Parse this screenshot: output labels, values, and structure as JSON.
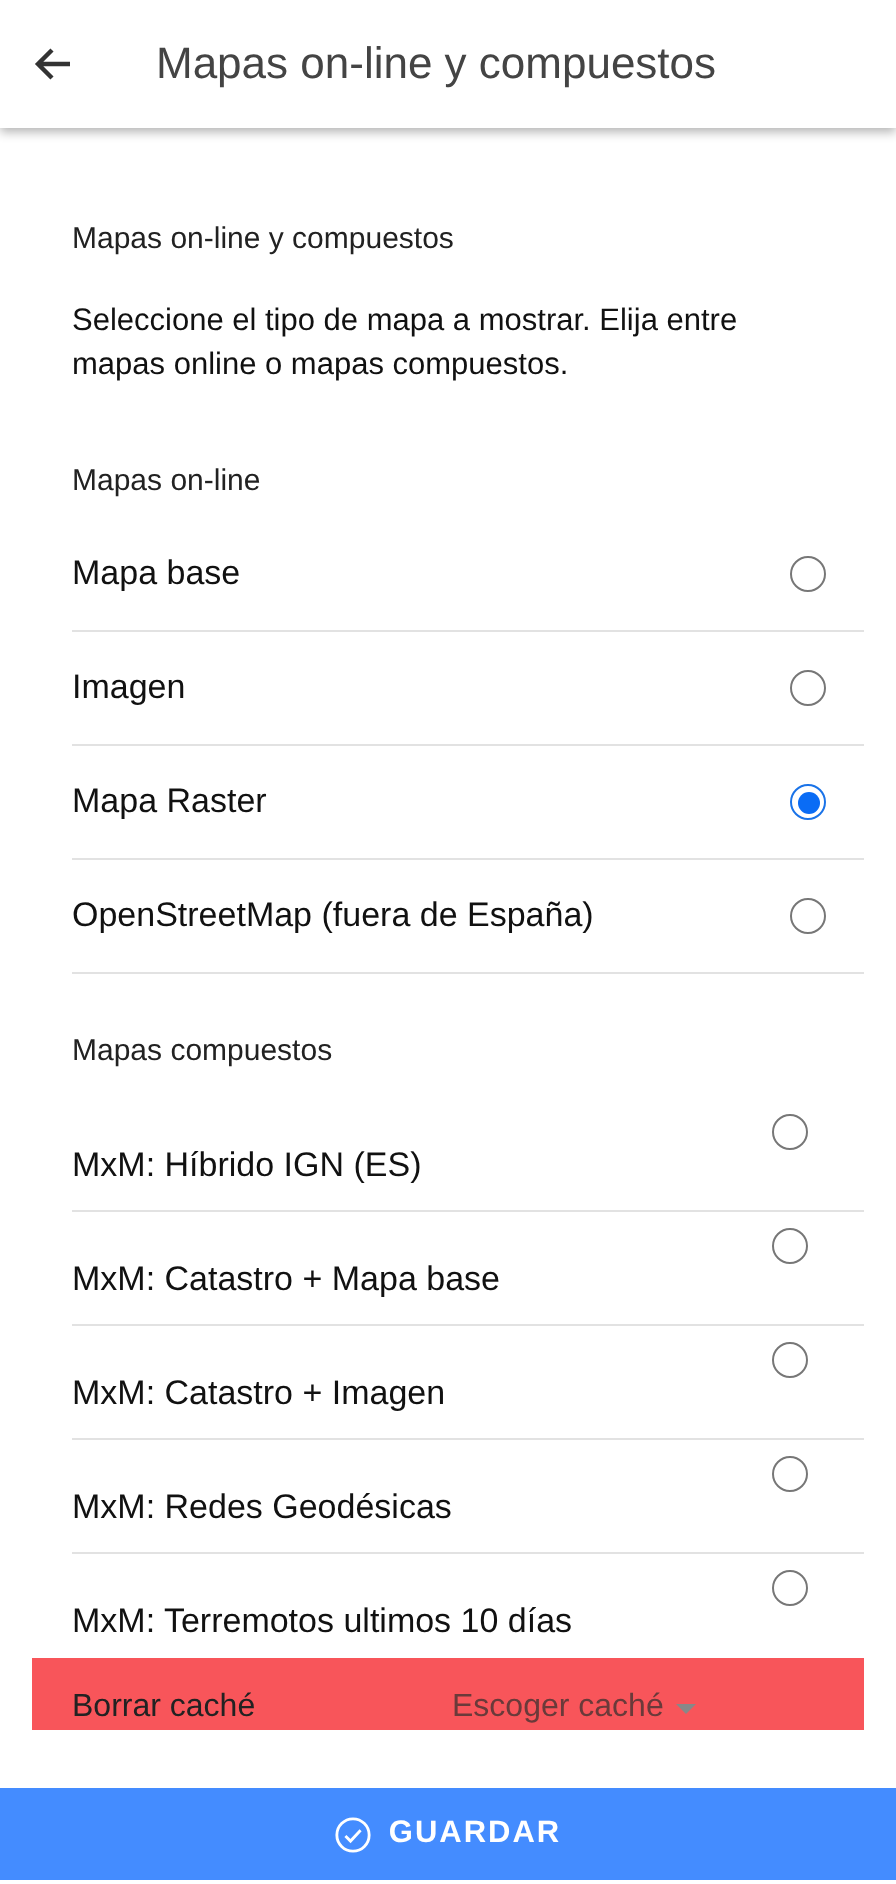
{
  "app_bar": {
    "title": "Mapas on-line y compuestos"
  },
  "section_title": "Mapas on-line y compuestos",
  "description": "Seleccione el tipo de mapa a mostrar. Elija entre mapas online o mapas compuestos.",
  "groups": [
    {
      "heading": "Mapas on-line",
      "kind": "online",
      "options": [
        {
          "label": "Mapa base",
          "selected": false
        },
        {
          "label": "Imagen",
          "selected": false
        },
        {
          "label": "Mapa Raster",
          "selected": true
        },
        {
          "label": "OpenStreetMap (fuera de España)",
          "selected": false
        }
      ]
    },
    {
      "heading": "Mapas compuestos",
      "kind": "composite",
      "options": [
        {
          "label": "MxM: Híbrido IGN (ES)",
          "selected": false
        },
        {
          "label": "MxM: Catastro + Mapa base",
          "selected": false
        },
        {
          "label": "MxM: Catastro + Imagen",
          "selected": false
        },
        {
          "label": "MxM: Redes Geodésicas",
          "selected": false
        },
        {
          "label": "MxM: Terremotos ultimos 10 días",
          "selected": false
        }
      ]
    }
  ],
  "cache_bar": {
    "label": "Borrar caché",
    "dropdown": {
      "placeholder": "Escoger caché"
    }
  },
  "save_button": {
    "label": "GUARDAR"
  }
}
